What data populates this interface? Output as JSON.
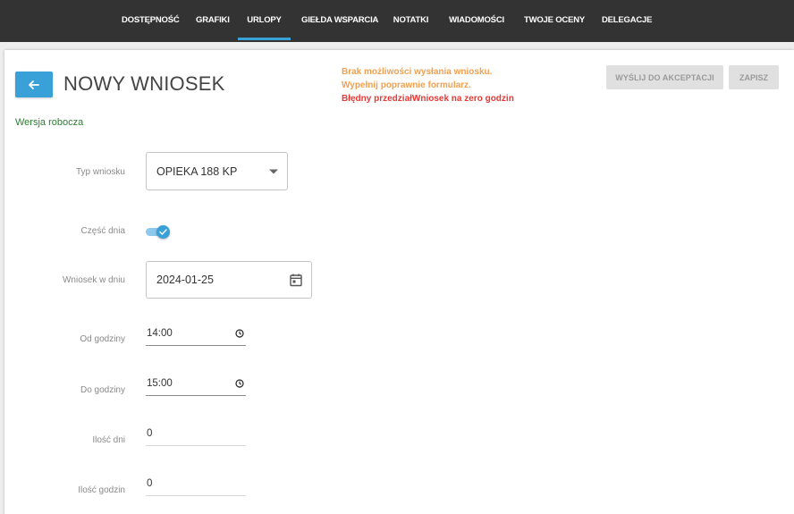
{
  "nav": {
    "items": [
      {
        "label": "DOSTĘPNOŚĆ"
      },
      {
        "label": "GRAFIKI"
      },
      {
        "label": "URLOPY",
        "active": true
      },
      {
        "label": "GIEŁDA WSPARCIA"
      },
      {
        "label": "NOTATKI"
      },
      {
        "label": "WIADOMOŚCI"
      },
      {
        "label": "TWOJE OCENY"
      },
      {
        "label": "DELEGACJE"
      }
    ]
  },
  "header": {
    "title": "NOWY WNIOSEK",
    "back_icon": "arrow-left-icon",
    "version": "Wersja robocza",
    "errors": {
      "line1": "Brak możliwości wysłania wniosku.",
      "line2": "Wypełnij poprawnie formularz.",
      "line3": "Błędny przedziałWniosek na zero godzin"
    },
    "send_label": "WYŚLIJ DO AKCEPTACJI",
    "save_label": "ZAPISZ"
  },
  "form": {
    "type": {
      "label": "Typ wniosku",
      "value": "OPIEKA 188 KP"
    },
    "part_day": {
      "label": "Część dnia",
      "checked": true
    },
    "date": {
      "label": "Wniosek w dniu",
      "value": "2024-01-25"
    },
    "from": {
      "label": "Od godziny",
      "value": "14:00"
    },
    "to": {
      "label": "Do godziny",
      "value": "15:00"
    },
    "days": {
      "label": "Ilość dni",
      "value": "0"
    },
    "hours": {
      "label": "Ilość godzin",
      "value": "0"
    }
  },
  "colors": {
    "accent": "#3aa0d8",
    "nav_bg": "#333333",
    "warning": "#f0a050",
    "error": "#e53935",
    "draft": "#2e7d32"
  }
}
